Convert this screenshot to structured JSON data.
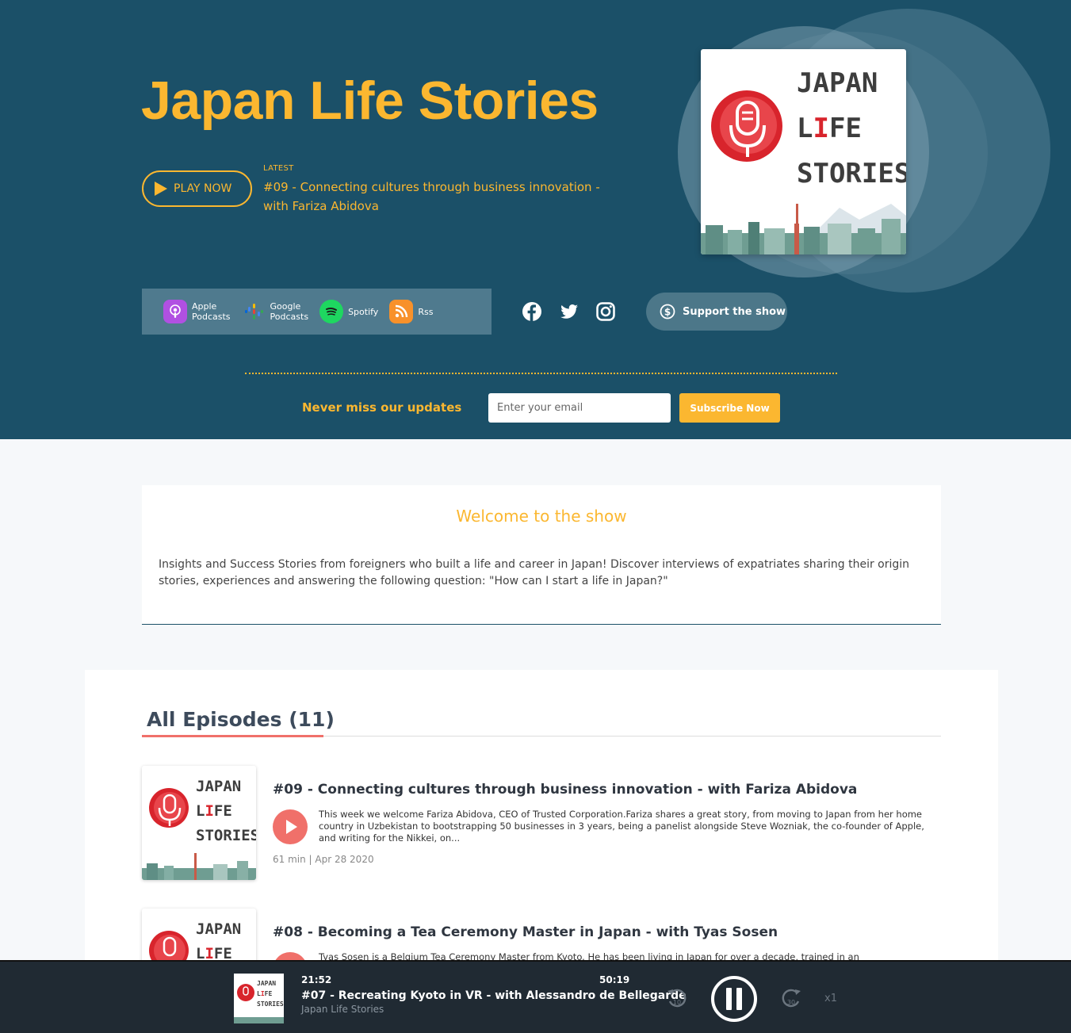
{
  "hero": {
    "title": "Japan Life Stories",
    "play_label": "PLAY NOW",
    "latest_label": "LATEST",
    "latest_title": "#09 - Connecting cultures through business innovation - with Fariza Abidova"
  },
  "cover": {
    "line1": "JAPAN",
    "line2_a": "L",
    "line2_b": "I",
    "line2_c": "FE",
    "line3": "STORIES"
  },
  "platforms": [
    {
      "label_1": "Apple",
      "label_2": "Podcasts",
      "icon": "apple-podcasts-icon"
    },
    {
      "label_1": "Google",
      "label_2": "Podcasts",
      "icon": "google-podcasts-icon"
    },
    {
      "label_1": "Spotify",
      "icon": "spotify-icon"
    },
    {
      "label_1": "Rss",
      "icon": "rss-icon"
    }
  ],
  "social": [
    "facebook-icon",
    "twitter-icon",
    "instagram-icon"
  ],
  "support_label": "Support the show",
  "newsletter": {
    "heading": "Never miss our updates",
    "placeholder": "Enter your email",
    "button": "Subscribe Now"
  },
  "welcome": {
    "title": "Welcome to the show",
    "body": "Insights and Success Stories from foreigners who built a life and career in Japan! Discover interviews of expatriates sharing their origin stories, experiences and answering the following question: \"How can I start a life in Japan?\""
  },
  "episodes": {
    "heading": "All Episodes (11)",
    "items": [
      {
        "title": "#09 - Connecting cultures through business innovation - with Fariza Abidova",
        "description": "This week we welcome Fariza Abidova, CEO of Trusted Corporation.Fariza shares a great story, from moving to Japan from her home country in Uzbekistan to bootstrapping 50 businesses in 3 years, being a panelist alongside Steve Wozniak, the co-founder of Apple, and writing for the Nikkei, on...",
        "meta": "61 min | Apr 28 2020"
      },
      {
        "title": "#08 - Becoming a Tea Ceremony Master in Japan - with Tyas Sosen",
        "description": "Tyas Sosen is a Belgium Tea Ceremony Master from Kyoto. He has been living in Japan for over a decade, trained in an",
        "meta": ""
      }
    ]
  },
  "player": {
    "current_time": "21:52",
    "duration": "50:19",
    "title": "#07 - Recreating Kyoto in VR - with Alessandro de Bellegarde",
    "show": "Japan Life Stories",
    "rewind_label": "10",
    "forward_label": "30",
    "speed": "x1"
  },
  "colors": {
    "hero_bg": "#1b5068",
    "accent": "#fbb730",
    "episode_accent": "#f0706a",
    "player_bg": "#202a33"
  }
}
